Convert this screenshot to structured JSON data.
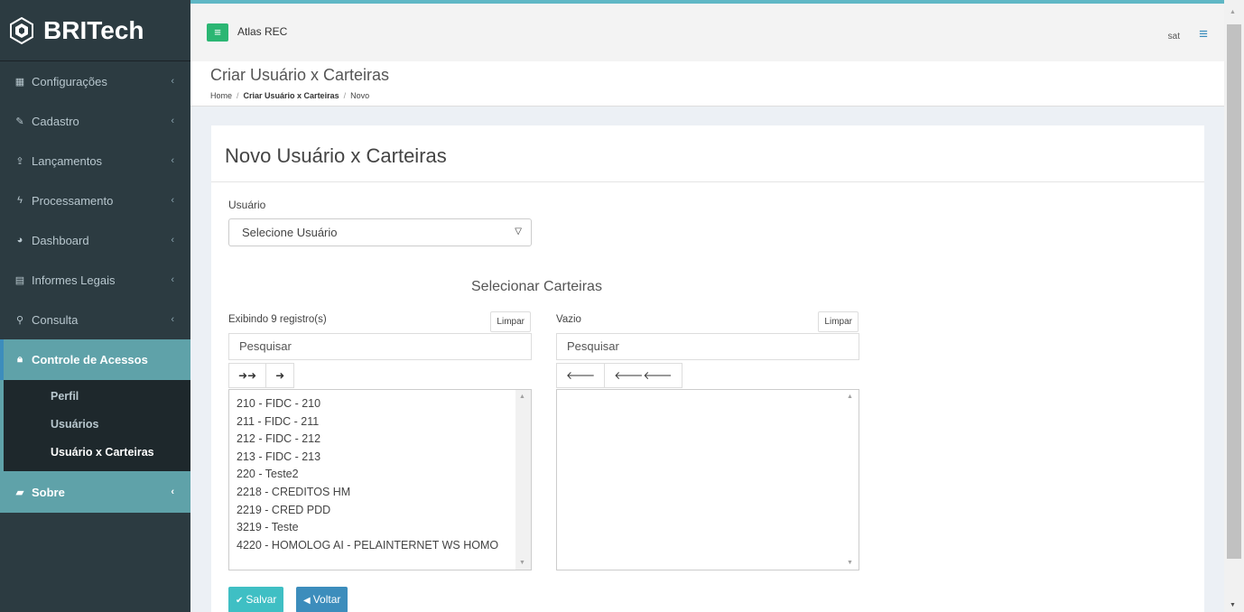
{
  "brand": {
    "name": "BRITech"
  },
  "topbar": {
    "menu_icon": "hamburger-icon",
    "app_title": "Atlas REC",
    "user": "sat"
  },
  "sidebar": {
    "items": [
      {
        "label": "Configurações",
        "icon": "grid-icon"
      },
      {
        "label": "Cadastro",
        "icon": "edit-icon"
      },
      {
        "label": "Lançamentos",
        "icon": "upload-icon"
      },
      {
        "label": "Processamento",
        "icon": "bolt-icon"
      },
      {
        "label": "Dashboard",
        "icon": "pie-chart-icon"
      },
      {
        "label": "Informes Legais",
        "icon": "building-icon"
      },
      {
        "label": "Consulta",
        "icon": "binoculars-icon"
      },
      {
        "label": "Controle de Acessos",
        "icon": "lock-icon"
      }
    ],
    "submenu": [
      "Perfil",
      "Usuários",
      "Usuário x Carteiras"
    ],
    "sobre": {
      "label": "Sobre",
      "icon": "book-icon"
    }
  },
  "header": {
    "title": "Criar Usuário x Carteiras",
    "breadcrumb": {
      "home": "Home",
      "current": "Criar Usuário x Carteiras",
      "last": "Novo"
    }
  },
  "form": {
    "title": "Novo Usuário x Carteiras",
    "usuario_label": "Usuário",
    "usuario_select": "Selecione Usuário",
    "selecionar_label": "Selecionar Carteiras",
    "left": {
      "info": "Exibindo 9 registro(s)",
      "clear": "Limpar",
      "search": "Pesquisar",
      "move_all": "➜➜",
      "move_one": "➜",
      "items": [
        "210 - FIDC - 210",
        "211 - FIDC - 211",
        "212 - FIDC - 212",
        "213 - FIDC - 213",
        "220 - Teste2",
        "2218 - CREDITOS HM",
        "2219 - CRED PDD",
        "3219 - Teste",
        "4220 - HOMOLOG AI - PELAINTERNET WS HOMO"
      ]
    },
    "right": {
      "info": "Vazio",
      "clear": "Limpar",
      "search": "Pesquisar",
      "remove_one": "🡐",
      "remove_all": "🡐🡐"
    },
    "save": "Salvar",
    "back": "Voltar"
  },
  "colors": {
    "sidebar": "#2c3b41",
    "active": "#5fa2a9",
    "accent": "#3c8dbc",
    "save": "#3fbfc4",
    "menu_btn": "#2bb673"
  }
}
